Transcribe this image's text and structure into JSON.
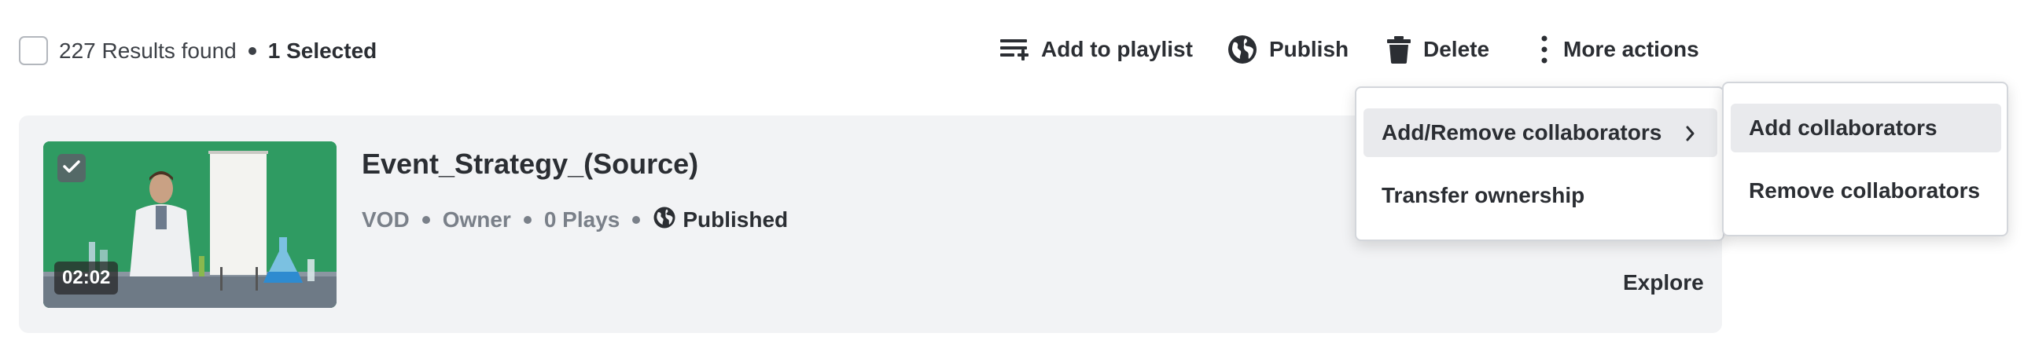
{
  "toolbar": {
    "results_text": "227 Results found",
    "selected_text": "1 Selected",
    "actions": {
      "add_to_playlist": "Add to playlist",
      "publish": "Publish",
      "delete": "Delete",
      "more_actions": "More actions"
    },
    "icons": {
      "add_to_playlist": "playlist-add-icon",
      "publish": "globe-icon",
      "delete": "trash-icon",
      "more_actions": "vertical-dots-icon"
    }
  },
  "asset": {
    "title": "Event_Strategy_(Source)",
    "duration": "02:02",
    "type": "VOD",
    "role": "Owner",
    "plays": "0 Plays",
    "status": "Published",
    "explore_label": "Explore",
    "selected": true
  },
  "more_actions_menu": {
    "items": [
      {
        "label": "Add/Remove collaborators",
        "has_submenu": true,
        "highlighted": true
      },
      {
        "label": "Transfer ownership",
        "has_submenu": false,
        "highlighted": false
      }
    ]
  },
  "collaborators_submenu": {
    "items": [
      {
        "label": "Add collaborators",
        "highlighted": true
      },
      {
        "label": "Remove collaborators",
        "highlighted": false
      }
    ]
  },
  "colors": {
    "text_primary": "#2b2e33",
    "text_muted": "#7a8089",
    "card_bg": "#f2f3f5",
    "menu_highlight": "#e9eaed",
    "thumbnail_backdrop": "#2f9b62"
  }
}
